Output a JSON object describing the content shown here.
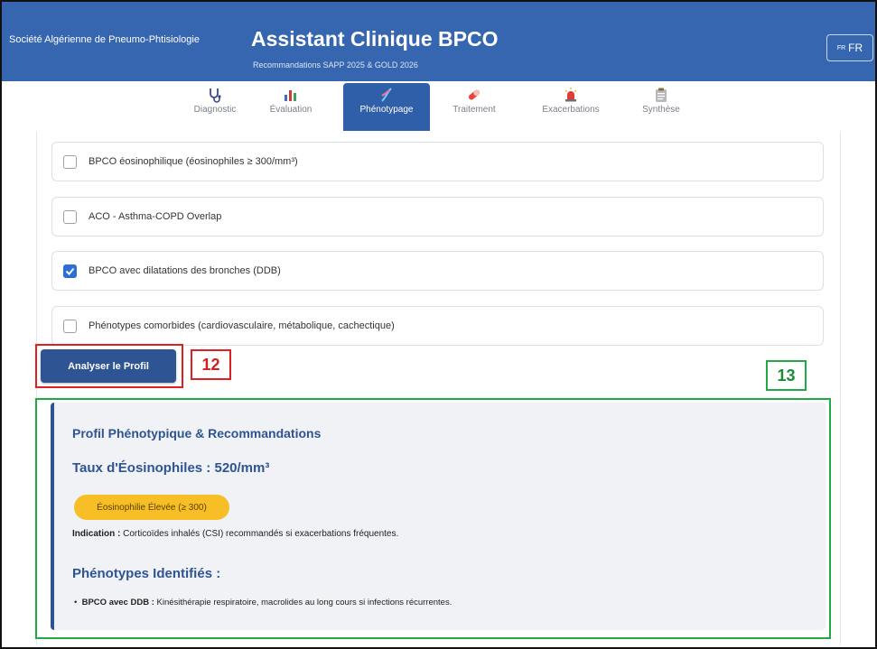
{
  "header": {
    "organization": "Société Algérienne de Pneumo-Phtisiologie",
    "title": "Assistant Clinique BPCO",
    "subtitle": "Recommandations SAPP 2025 & GOLD 2026",
    "language": {
      "flag": "FR",
      "label": "FR"
    }
  },
  "nav": {
    "tabs": [
      {
        "label": "Diagnostic",
        "icon": "stethoscope-icon"
      },
      {
        "label": "Évaluation",
        "icon": "bar-chart-icon"
      },
      {
        "label": "Phénotypage",
        "icon": "dna-icon",
        "active": true
      },
      {
        "label": "Traitement",
        "icon": "pill-icon"
      },
      {
        "label": "Exacerbations",
        "icon": "alarm-light-icon"
      },
      {
        "label": "Synthèse",
        "icon": "clipboard-icon"
      }
    ]
  },
  "options": [
    {
      "label": "BPCO éosinophilique (éosinophiles ≥ 300/mm³)",
      "checked": false
    },
    {
      "label": "ACO - Asthma-COPD Overlap",
      "checked": false
    },
    {
      "label": "BPCO avec dilatations des bronches (DDB)",
      "checked": true
    },
    {
      "label": "Phénotypes comorbides (cardiovasculaire, métabolique, cachectique)",
      "checked": false
    }
  ],
  "analyze_button": "Analyser le Profil",
  "annotations": {
    "m12": "12",
    "m13": "13"
  },
  "colors": {
    "header": "#3766b0",
    "accent": "#2f5494",
    "badge": "#f7be25",
    "red_annotation": "#e02020",
    "green_annotation": "#22a845"
  },
  "result": {
    "title": "Profil Phénotypique & Recommandations",
    "eos_title": "Taux d'Éosinophiles : 520/mm³",
    "badge": "Éosinophilie Élevée (≥ 300)",
    "indication_label": "Indication :",
    "indication_text": "Corticoïdes inhalés (CSI) recommandés si exacerbations fréquentes.",
    "phenotypes_title": "Phénotypes Identifiés :",
    "phenotypes": [
      {
        "name": "BPCO avec DDB :",
        "text": "Kinésithérapie respiratoire, macrolides au long cours si infections récurrentes."
      }
    ]
  }
}
